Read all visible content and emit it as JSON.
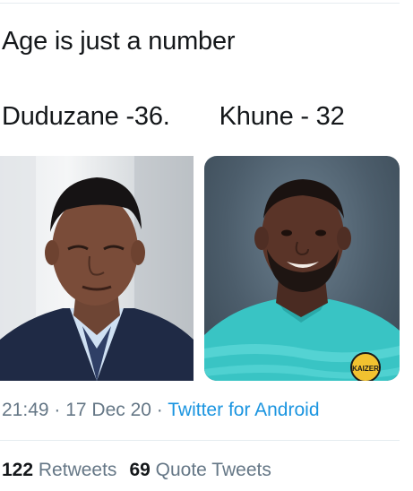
{
  "tweet": {
    "text_line1": "Age is just a number",
    "text_line2": "Duduzane -36.       Khune - 32"
  },
  "media": {
    "images": [
      {
        "icon": "person-photo-icon"
      },
      {
        "icon": "person-photo-icon",
        "badge_text": "KAIZER"
      }
    ]
  },
  "meta": {
    "time": "21:49",
    "separator1": " · ",
    "date": "17 Dec 20",
    "separator2": " · ",
    "source": "Twitter for Android"
  },
  "stats": {
    "retweets_count": "122",
    "retweets_label": "Retweets",
    "quotes_count": "69",
    "quotes_label": "Quote Tweets"
  },
  "colors": {
    "text": "#14171a",
    "muted": "#657786",
    "link": "#1b95e0",
    "divider": "#e6ecf0"
  }
}
